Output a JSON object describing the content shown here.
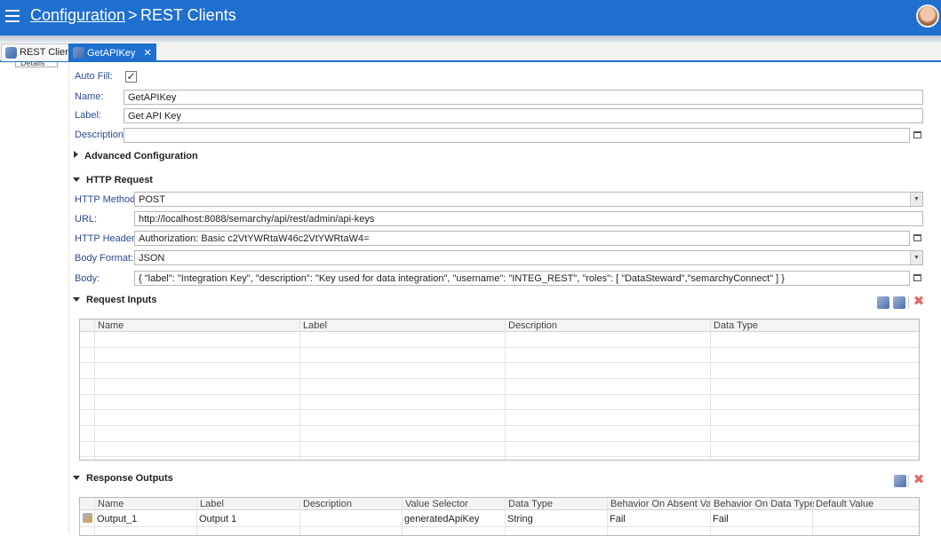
{
  "header": {
    "breadcrumb_link": "Configuration",
    "separator": ">",
    "title": "REST Clients",
    "menu_icon": "hamburger-menu-icon",
    "avatar_icon": "user-avatar"
  },
  "tabs": [
    {
      "label": "REST Clients",
      "icon": "rest-client-icon",
      "active": false
    },
    {
      "label": "GetAPIKey",
      "icon": "rest-client-icon",
      "active": true,
      "close": "✕"
    }
  ],
  "details_label": "Details",
  "form": {
    "auto_fill_label": "Auto Fill:",
    "auto_fill_checked": true,
    "name_label": "Name:",
    "name_value": "GetAPIKey",
    "label_label": "Label:",
    "label_value": "Get API Key",
    "description_label": "Description:",
    "description_value": ""
  },
  "sections": {
    "advanced": "Advanced Configuration",
    "http_request": "HTTP Request",
    "request_inputs": "Request Inputs",
    "response_outputs": "Response Outputs"
  },
  "http": {
    "method_label": "HTTP Method:",
    "method_value": "POST",
    "url_label": "URL:",
    "url_value": "http://localhost:8088/semarchy/api/rest/admin/api-keys",
    "headers_label": "HTTP Headers:",
    "headers_value": "Authorization: Basic c2VtYWRtaW46c2VtYWRtaW4=",
    "body_format_label": "Body Format:",
    "body_format_value": "JSON",
    "body_label": "Body:",
    "body_value": "{   \"label\": \"Integration Key\",   \"description\": \"Key used for data integration\",   \"username\": \"INTEG_REST\",   \"roles\": [      \"DataSteward\",\"semarchyConnect\"   ] }"
  },
  "request_inputs": {
    "columns": [
      "Name",
      "Label",
      "Description",
      "Data Type"
    ],
    "rows": []
  },
  "response_outputs": {
    "columns": [
      "Name",
      "Label",
      "Description",
      "Value Selector",
      "Data Type",
      "Behavior On Absent Value",
      "Behavior On Data Type ...",
      "Default Value"
    ],
    "rows": [
      [
        "Output_1",
        "Output 1",
        "",
        "generatedApiKey",
        "String",
        "Fail",
        "Fail",
        ""
      ]
    ]
  },
  "colors": {
    "header_bg": "#1f6fcf",
    "label_blue": "#2b4a8f",
    "delete_red": "#e06a6a"
  }
}
